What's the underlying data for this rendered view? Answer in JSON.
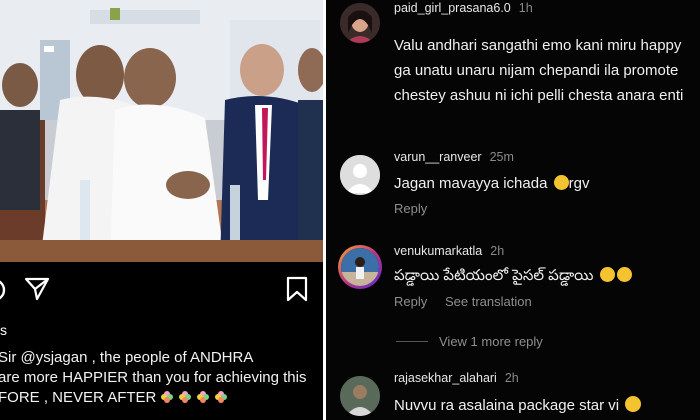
{
  "post": {
    "likes_fragment": "s",
    "caption_lines": [
      "Sir @ysjagan , the people of ANDHRA",
      "are more HAPPIER than you for achieving this",
      "FORE , NEVER AFTER"
    ]
  },
  "comments": [
    {
      "username": "paid_girl_prasana6.0",
      "time": "1h",
      "lines": [
        "Valu andhari sangathi emo kani miru happy",
        "ga unatu unaru nijam chepandi ila promote",
        "chestey ashuu ni ichi pelli chesta anara enti"
      ]
    },
    {
      "username": "varun__ranveer",
      "time": "25m",
      "text": "Jagan mavayya ichada",
      "suffix": "rgv",
      "reply": "Reply"
    },
    {
      "username": "venukumarkatla",
      "time": "2h",
      "text": "పడ్డాయి పేటియంలో పైసల్ పడ్డాయి",
      "reply": "Reply",
      "translation": "See translation"
    },
    {
      "username": "rajasekhar_alahari",
      "time": "2h",
      "text": "Nuvvu ra asalaina package star vi"
    }
  ],
  "view_more": "View 1 more reply",
  "icons": [
    "share-icon",
    "bookmark-icon",
    "emoji-laugh-icon",
    "emoji-wink-icon",
    "flower-emoji-icon"
  ],
  "colors": {
    "background": "#000000",
    "muted": "#8e8e8e",
    "text": "#f0f0f0",
    "accent_ring": "#c13584"
  }
}
